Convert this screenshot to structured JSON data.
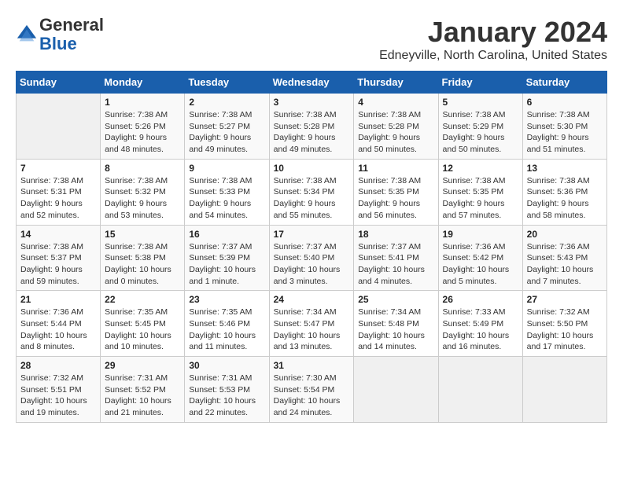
{
  "header": {
    "logo_text_general": "General",
    "logo_text_blue": "Blue",
    "title": "January 2024",
    "subtitle": "Edneyville, North Carolina, United States"
  },
  "weekdays": [
    "Sunday",
    "Monday",
    "Tuesday",
    "Wednesday",
    "Thursday",
    "Friday",
    "Saturday"
  ],
  "weeks": [
    [
      {
        "day": "",
        "info": ""
      },
      {
        "day": "1",
        "info": "Sunrise: 7:38 AM\nSunset: 5:26 PM\nDaylight: 9 hours\nand 48 minutes."
      },
      {
        "day": "2",
        "info": "Sunrise: 7:38 AM\nSunset: 5:27 PM\nDaylight: 9 hours\nand 49 minutes."
      },
      {
        "day": "3",
        "info": "Sunrise: 7:38 AM\nSunset: 5:28 PM\nDaylight: 9 hours\nand 49 minutes."
      },
      {
        "day": "4",
        "info": "Sunrise: 7:38 AM\nSunset: 5:28 PM\nDaylight: 9 hours\nand 50 minutes."
      },
      {
        "day": "5",
        "info": "Sunrise: 7:38 AM\nSunset: 5:29 PM\nDaylight: 9 hours\nand 50 minutes."
      },
      {
        "day": "6",
        "info": "Sunrise: 7:38 AM\nSunset: 5:30 PM\nDaylight: 9 hours\nand 51 minutes."
      }
    ],
    [
      {
        "day": "7",
        "info": "Sunrise: 7:38 AM\nSunset: 5:31 PM\nDaylight: 9 hours\nand 52 minutes."
      },
      {
        "day": "8",
        "info": "Sunrise: 7:38 AM\nSunset: 5:32 PM\nDaylight: 9 hours\nand 53 minutes."
      },
      {
        "day": "9",
        "info": "Sunrise: 7:38 AM\nSunset: 5:33 PM\nDaylight: 9 hours\nand 54 minutes."
      },
      {
        "day": "10",
        "info": "Sunrise: 7:38 AM\nSunset: 5:34 PM\nDaylight: 9 hours\nand 55 minutes."
      },
      {
        "day": "11",
        "info": "Sunrise: 7:38 AM\nSunset: 5:35 PM\nDaylight: 9 hours\nand 56 minutes."
      },
      {
        "day": "12",
        "info": "Sunrise: 7:38 AM\nSunset: 5:35 PM\nDaylight: 9 hours\nand 57 minutes."
      },
      {
        "day": "13",
        "info": "Sunrise: 7:38 AM\nSunset: 5:36 PM\nDaylight: 9 hours\nand 58 minutes."
      }
    ],
    [
      {
        "day": "14",
        "info": "Sunrise: 7:38 AM\nSunset: 5:37 PM\nDaylight: 9 hours\nand 59 minutes."
      },
      {
        "day": "15",
        "info": "Sunrise: 7:38 AM\nSunset: 5:38 PM\nDaylight: 10 hours\nand 0 minutes."
      },
      {
        "day": "16",
        "info": "Sunrise: 7:37 AM\nSunset: 5:39 PM\nDaylight: 10 hours\nand 1 minute."
      },
      {
        "day": "17",
        "info": "Sunrise: 7:37 AM\nSunset: 5:40 PM\nDaylight: 10 hours\nand 3 minutes."
      },
      {
        "day": "18",
        "info": "Sunrise: 7:37 AM\nSunset: 5:41 PM\nDaylight: 10 hours\nand 4 minutes."
      },
      {
        "day": "19",
        "info": "Sunrise: 7:36 AM\nSunset: 5:42 PM\nDaylight: 10 hours\nand 5 minutes."
      },
      {
        "day": "20",
        "info": "Sunrise: 7:36 AM\nSunset: 5:43 PM\nDaylight: 10 hours\nand 7 minutes."
      }
    ],
    [
      {
        "day": "21",
        "info": "Sunrise: 7:36 AM\nSunset: 5:44 PM\nDaylight: 10 hours\nand 8 minutes."
      },
      {
        "day": "22",
        "info": "Sunrise: 7:35 AM\nSunset: 5:45 PM\nDaylight: 10 hours\nand 10 minutes."
      },
      {
        "day": "23",
        "info": "Sunrise: 7:35 AM\nSunset: 5:46 PM\nDaylight: 10 hours\nand 11 minutes."
      },
      {
        "day": "24",
        "info": "Sunrise: 7:34 AM\nSunset: 5:47 PM\nDaylight: 10 hours\nand 13 minutes."
      },
      {
        "day": "25",
        "info": "Sunrise: 7:34 AM\nSunset: 5:48 PM\nDaylight: 10 hours\nand 14 minutes."
      },
      {
        "day": "26",
        "info": "Sunrise: 7:33 AM\nSunset: 5:49 PM\nDaylight: 10 hours\nand 16 minutes."
      },
      {
        "day": "27",
        "info": "Sunrise: 7:32 AM\nSunset: 5:50 PM\nDaylight: 10 hours\nand 17 minutes."
      }
    ],
    [
      {
        "day": "28",
        "info": "Sunrise: 7:32 AM\nSunset: 5:51 PM\nDaylight: 10 hours\nand 19 minutes."
      },
      {
        "day": "29",
        "info": "Sunrise: 7:31 AM\nSunset: 5:52 PM\nDaylight: 10 hours\nand 21 minutes."
      },
      {
        "day": "30",
        "info": "Sunrise: 7:31 AM\nSunset: 5:53 PM\nDaylight: 10 hours\nand 22 minutes."
      },
      {
        "day": "31",
        "info": "Sunrise: 7:30 AM\nSunset: 5:54 PM\nDaylight: 10 hours\nand 24 minutes."
      },
      {
        "day": "",
        "info": ""
      },
      {
        "day": "",
        "info": ""
      },
      {
        "day": "",
        "info": ""
      }
    ]
  ]
}
